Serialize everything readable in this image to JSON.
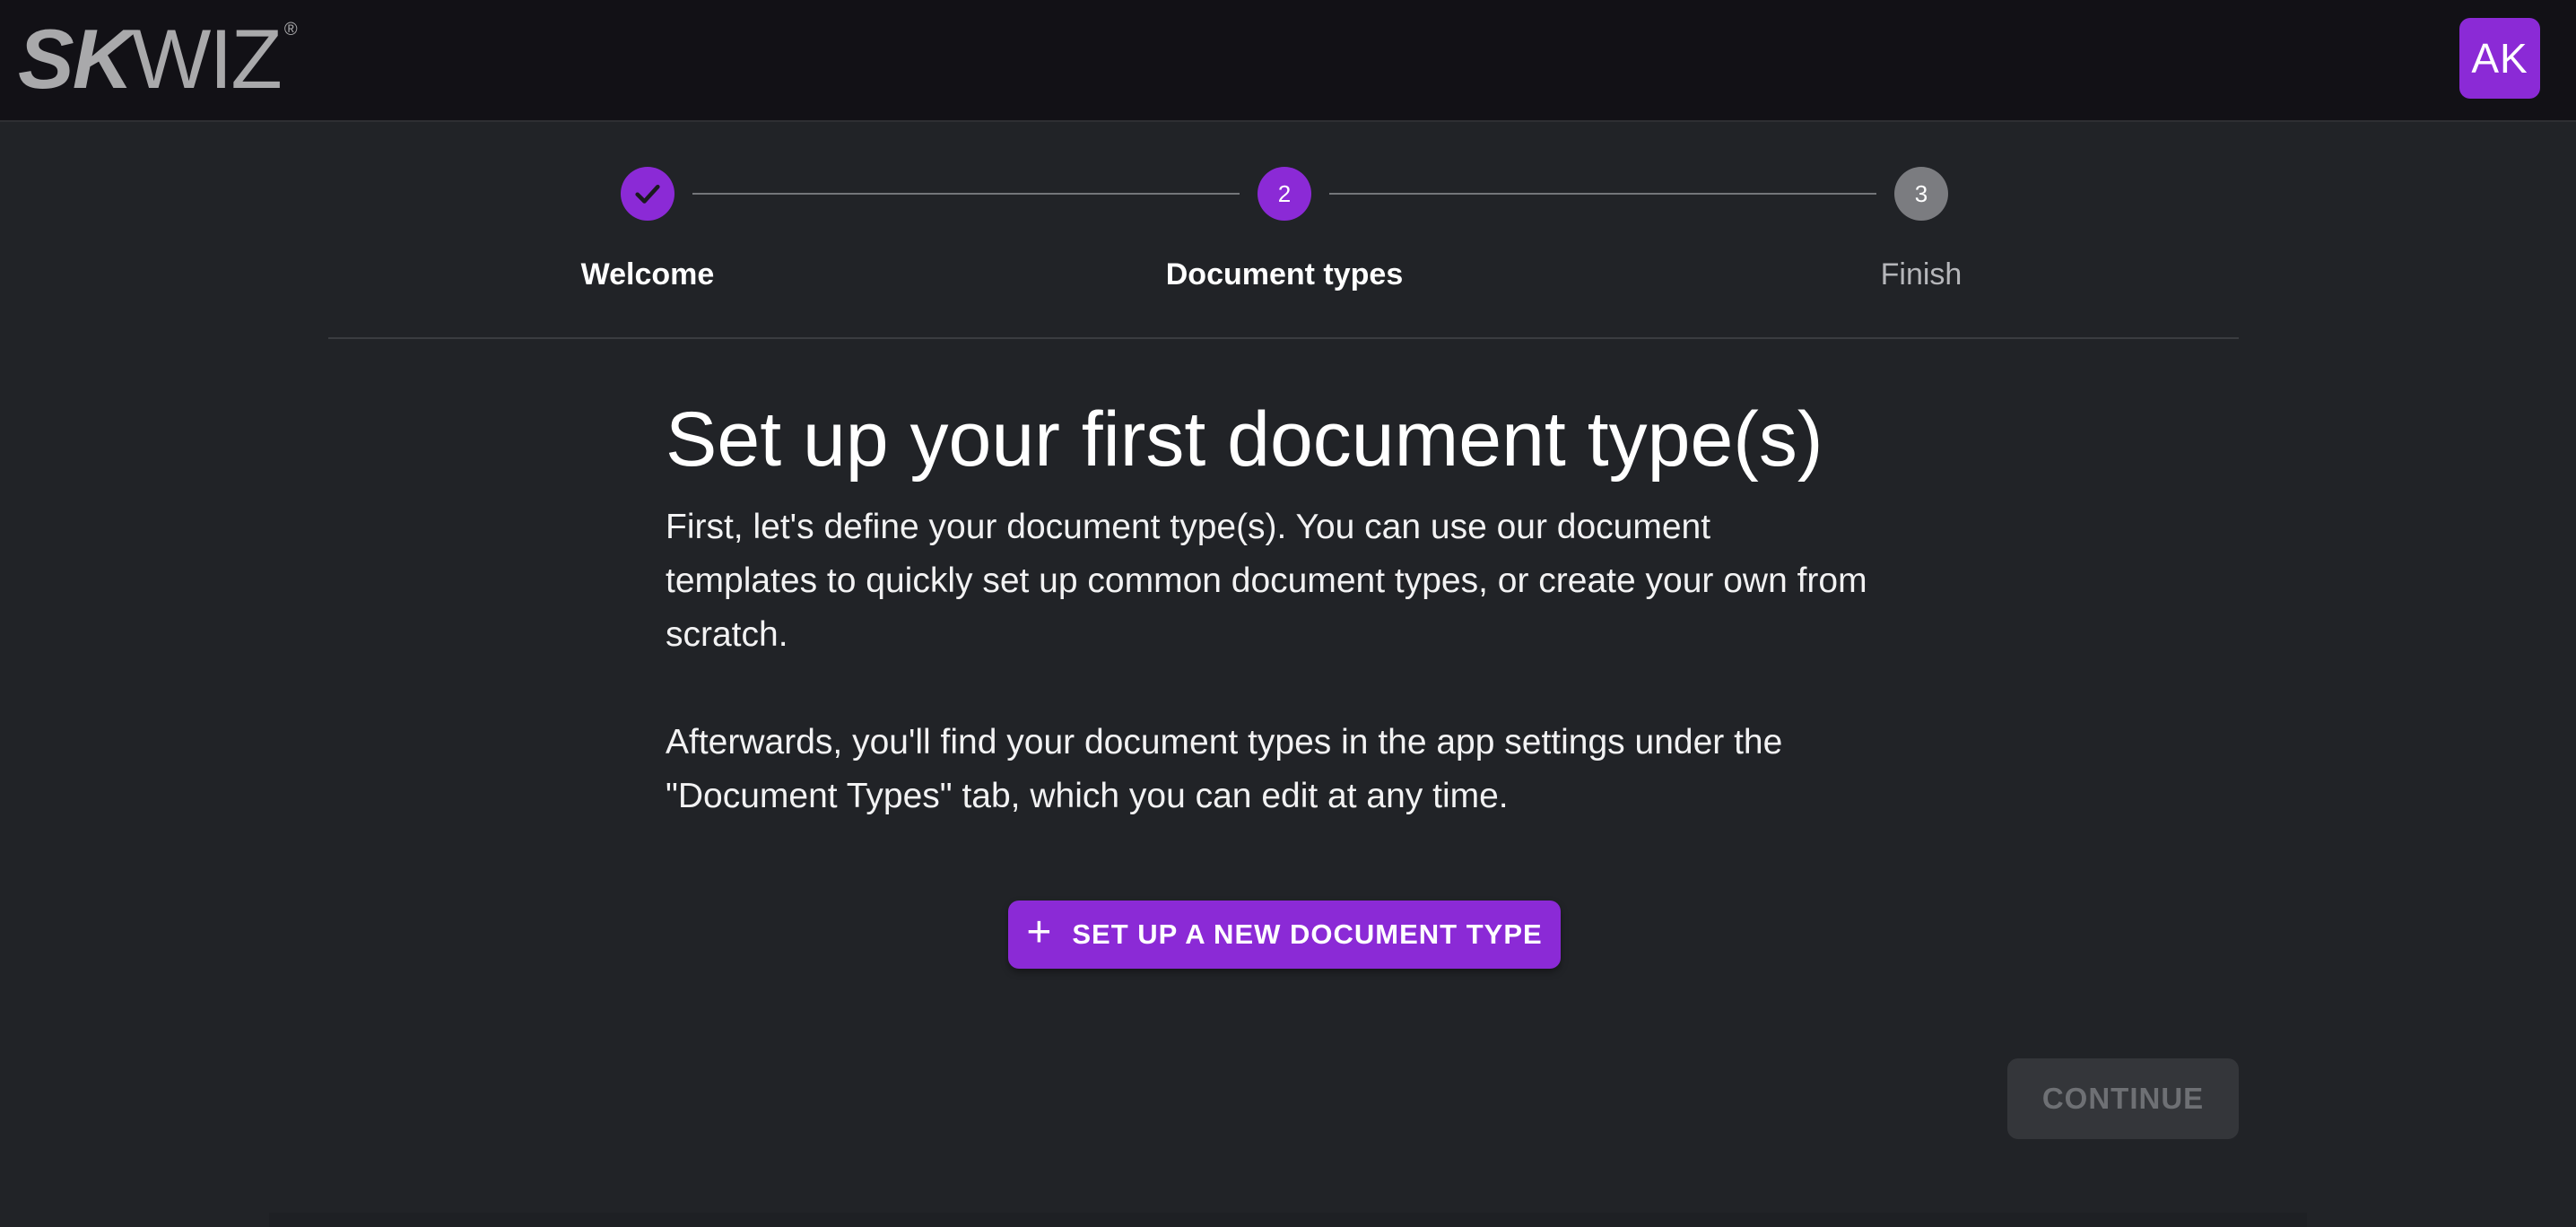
{
  "header": {
    "logo_sk": "SK",
    "logo_wiz": "WIZ",
    "logo_reg": "®",
    "avatar_initials": "AK"
  },
  "stepper": {
    "steps": [
      {
        "label": "Welcome",
        "status": "completed",
        "icon": "check-icon"
      },
      {
        "label": "Document types",
        "number": "2",
        "status": "active"
      },
      {
        "label": "Finish",
        "number": "3",
        "status": "inactive"
      }
    ]
  },
  "main": {
    "title": "Set up your first document type(s)",
    "paragraph_1": "First, let's define your document type(s). You can use our document templates to quickly set up common document types, or create your own from scratch.",
    "paragraph_2": "Afterwards, you'll find your document types in the app settings under the \"Document Types\" tab, which you can edit at any time.",
    "new_doc_type_button": "SET UP A NEW DOCUMENT TYPE",
    "continue_button": "CONTINUE",
    "continue_disabled": true
  },
  "colors": {
    "accent": "#8b2ad6",
    "background": "#212327",
    "header_bg": "#121116",
    "inactive_step": "#7b7c80",
    "disabled_button_bg": "#34363a",
    "disabled_button_text": "#6e7074"
  }
}
